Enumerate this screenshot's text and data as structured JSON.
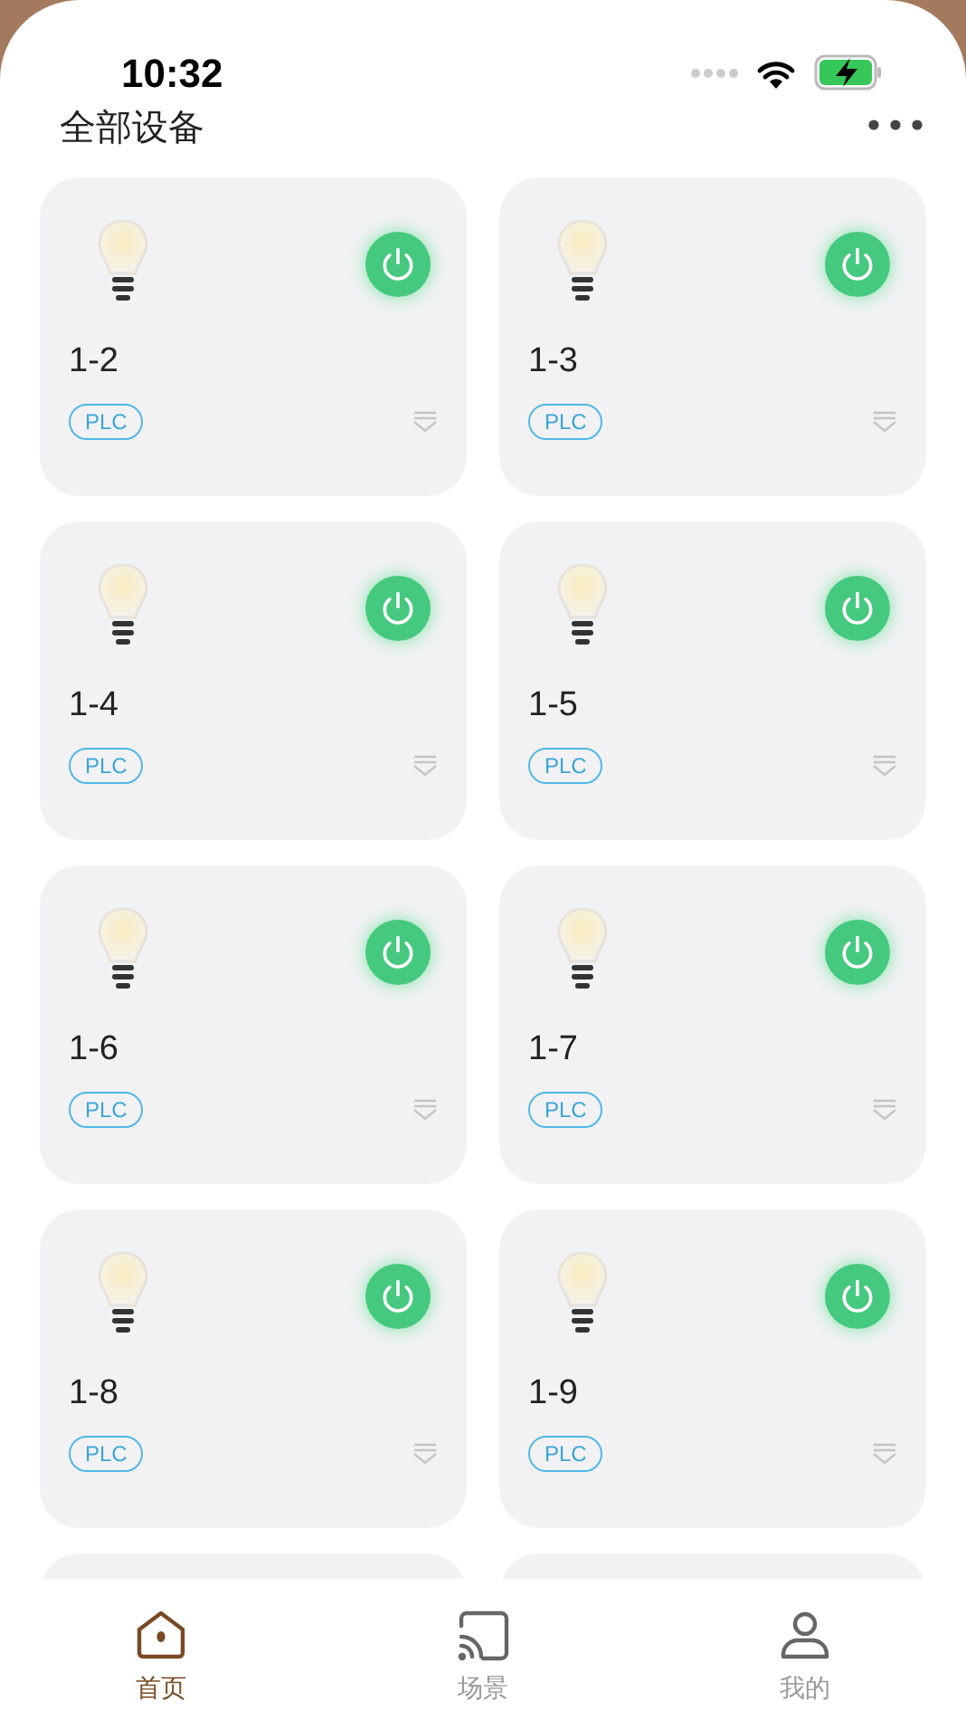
{
  "status_bar": {
    "time": "10:32"
  },
  "header": {
    "title": "全部设备"
  },
  "devices": [
    {
      "name": "1-2",
      "tag": "PLC",
      "on": true
    },
    {
      "name": "1-3",
      "tag": "PLC",
      "on": true
    },
    {
      "name": "1-4",
      "tag": "PLC",
      "on": true
    },
    {
      "name": "1-5",
      "tag": "PLC",
      "on": true
    },
    {
      "name": "1-6",
      "tag": "PLC",
      "on": true
    },
    {
      "name": "1-7",
      "tag": "PLC",
      "on": true
    },
    {
      "name": "1-8",
      "tag": "PLC",
      "on": true
    },
    {
      "name": "1-9",
      "tag": "PLC",
      "on": true
    }
  ],
  "tab_bar": [
    {
      "kind": "home",
      "label": "首页",
      "selected": true
    },
    {
      "kind": "scene",
      "label": "场景",
      "selected": false
    },
    {
      "kind": "profile",
      "label": "我的",
      "selected": false
    }
  ]
}
